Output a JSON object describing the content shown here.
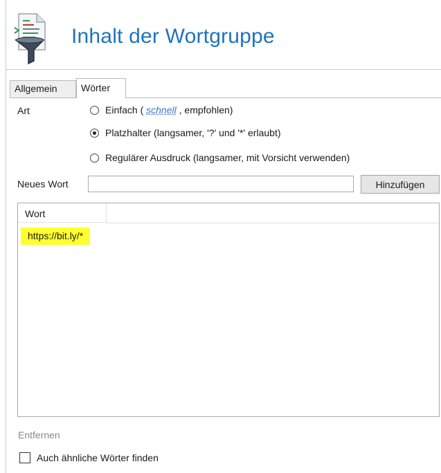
{
  "header": {
    "title": "Inhalt der Wortgruppe",
    "icon": "word-filter-document-icon"
  },
  "tabs": [
    {
      "label": "Allgemein",
      "active": false
    },
    {
      "label": "Wörter",
      "active": true
    }
  ],
  "art": {
    "label": "Art",
    "options": [
      {
        "prefix": "Einfach ( ",
        "link": "schnell",
        "suffix": " , empfohlen)",
        "selected": false
      },
      {
        "text": "Platzhalter (langsamer, '?' und '*' erlaubt)",
        "selected": true
      },
      {
        "text": "Regulärer Ausdruck (langsamer, mit Vorsicht verwenden)",
        "selected": false
      }
    ]
  },
  "new_word": {
    "label": "Neues Wort",
    "value": "",
    "button_label": "Hinzufügen"
  },
  "word_list": {
    "column_header": "Wort",
    "rows": [
      {
        "value": "https://bit.ly/*",
        "highlight": "#ffff2e"
      }
    ]
  },
  "remove_label": "Entfernen",
  "similar_words": {
    "label": "Auch ähnliche Wörter finden",
    "checked": false
  },
  "colors": {
    "title": "#1e73be",
    "link": "#3b78c4",
    "highlight": "#ffff2e"
  }
}
